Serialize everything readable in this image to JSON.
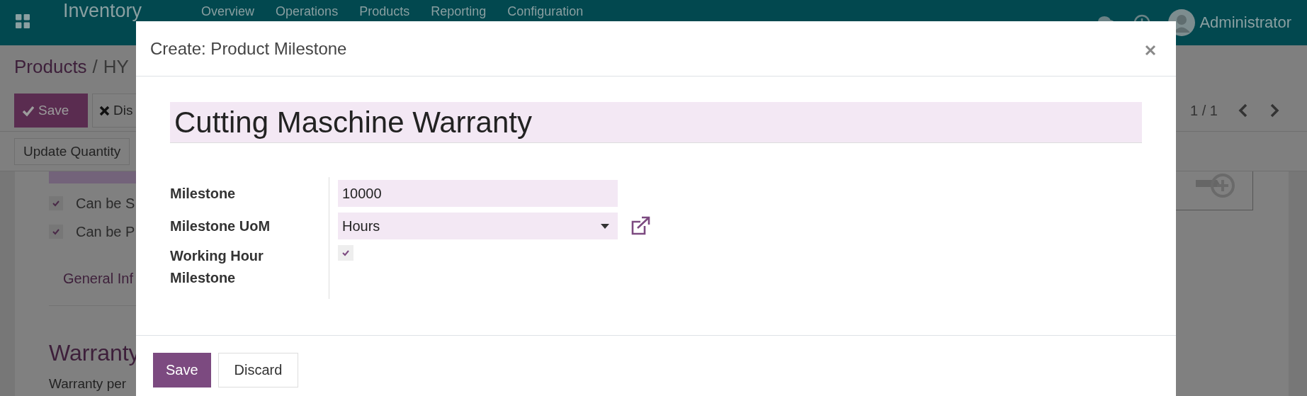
{
  "app_bar": {
    "app_name": "Inventory",
    "menu": [
      "Overview",
      "Operations",
      "Products",
      "Reporting",
      "Configuration"
    ],
    "user": "Administrator"
  },
  "breadcrumb": {
    "items": [
      "Products",
      "HY"
    ],
    "separator": "/"
  },
  "actions": [
    {
      "label": "Save",
      "kind": "primary"
    },
    {
      "label": "Dis",
      "kind": "secondary"
    }
  ],
  "pager": "1 / 1",
  "status_actions": [
    "Update Quantity"
  ],
  "product_options": [
    {
      "label": "Can be S",
      "checked": true
    },
    {
      "label": "Can be P",
      "checked": true
    }
  ],
  "notebook_tabs": [
    "General Inf"
  ],
  "section_title": "Warranty",
  "section_text": "Warranty per",
  "dialog": {
    "title": "Create: Product Milestone",
    "name": "Cutting Maschine Warranty",
    "fields": [
      {
        "kind": "input",
        "label": "Milestone",
        "value": "10000"
      },
      {
        "kind": "select",
        "label": "Milestone UoM",
        "value": "Hours"
      },
      {
        "kind": "checkbox",
        "label": "Working Hour Milestone",
        "checked": true
      }
    ],
    "buttons": [
      {
        "label": "Save",
        "kind": "primary"
      },
      {
        "label": "Discard",
        "kind": "secondary"
      }
    ]
  }
}
